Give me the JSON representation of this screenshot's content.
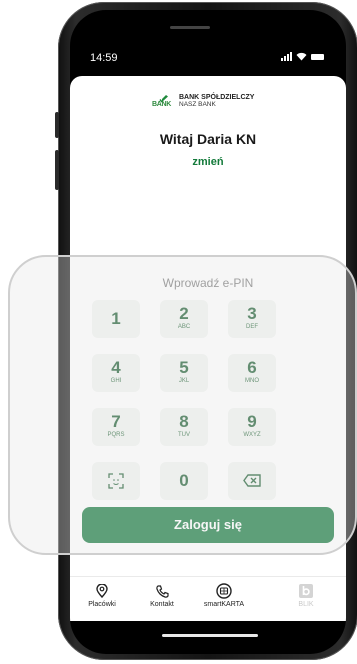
{
  "status": {
    "time": "14:59"
  },
  "bank": {
    "small_mark": "NASZ",
    "mark": "BANK",
    "name_line1": "BANK SPÓŁDZIELCZY",
    "name_line2": "NASZ BANK"
  },
  "greeting": "Witaj Daria KN",
  "change_link": "zmień",
  "pin_label": "Wprowadź e-PIN",
  "keys": [
    {
      "digit": "1",
      "letters": ""
    },
    {
      "digit": "2",
      "letters": "ABC"
    },
    {
      "digit": "3",
      "letters": "DEF"
    },
    {
      "digit": "4",
      "letters": "GHI"
    },
    {
      "digit": "5",
      "letters": "JKL"
    },
    {
      "digit": "6",
      "letters": "MNO"
    },
    {
      "digit": "7",
      "letters": "PQRS"
    },
    {
      "digit": "8",
      "letters": "TUV"
    },
    {
      "digit": "9",
      "letters": "WXYZ"
    },
    {
      "digit": "0",
      "letters": ""
    }
  ],
  "special_keys": {
    "biometric_icon": "face-scan-icon",
    "delete_icon": "backspace-icon"
  },
  "login_button": "Zaloguj się",
  "bottom_nav": [
    {
      "label": "Placówki",
      "icon": "location-pin-icon"
    },
    {
      "label": "Kontakt",
      "icon": "phone-icon"
    },
    {
      "label": "smartKARTA",
      "icon": "smartkarta-icon"
    },
    {
      "label": "BLIK",
      "icon": "blik-icon"
    }
  ],
  "colors": {
    "brand_green": "#167a3f",
    "key_bg": "#f2f4f2",
    "text_green": "#137a3a"
  }
}
